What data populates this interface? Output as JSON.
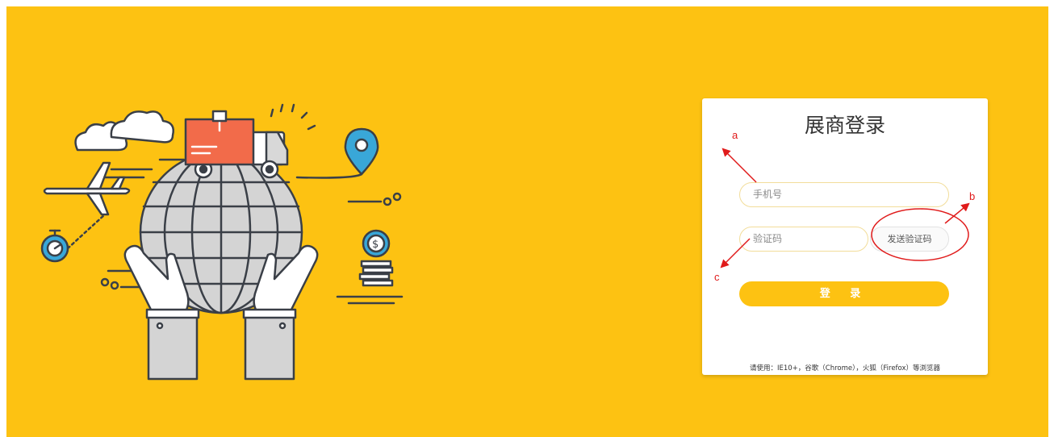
{
  "login_card": {
    "title": "展商登录",
    "phone_placeholder": "手机号",
    "code_placeholder": "验证码",
    "send_code_label": "发送验证码",
    "login_label": "登 录",
    "browser_note": "请使用：IE10+，谷歌（Chrome），火狐（Firefox）等浏览器"
  },
  "annotations": {
    "a": "a",
    "b": "b",
    "c": "c"
  },
  "colors": {
    "background": "#fdc212",
    "annotation": "#e01b1b",
    "card": "#ffffff",
    "illustration_line": "#3a3f47",
    "box": "#f26b4a",
    "pin": "#39a7d8"
  },
  "illustration": {
    "icons": [
      "cloud-icon",
      "airplane-icon",
      "stopwatch-icon",
      "globe-icon",
      "delivery-truck-icon",
      "parcel-box-icon",
      "location-pin-icon",
      "dollar-coin-icon",
      "hands-icon"
    ]
  }
}
